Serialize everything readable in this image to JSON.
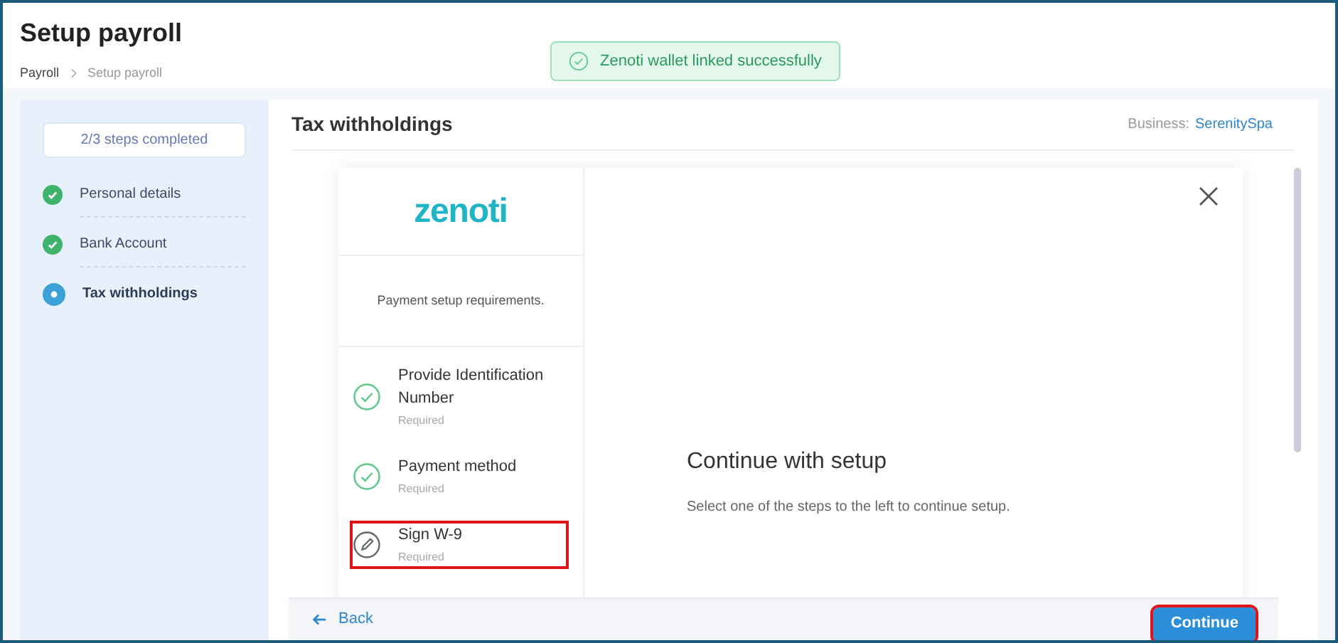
{
  "page": {
    "title": "Setup payroll",
    "breadcrumb": [
      {
        "label": "Payroll",
        "current": false
      },
      {
        "label": "Setup payroll",
        "current": true
      }
    ]
  },
  "toast": {
    "message": "Zenoti wallet linked successfully"
  },
  "stepper": {
    "progress": "2/3 steps completed",
    "steps": [
      {
        "label": "Personal details",
        "kind": "done"
      },
      {
        "label": "Bank Account",
        "kind": "done"
      },
      {
        "label": "Tax withholdings",
        "kind": "current"
      }
    ]
  },
  "section": {
    "title": "Tax withholdings",
    "business_label": "Business:",
    "business_name": "SerenitySpa"
  },
  "modal": {
    "logo": "zenoti",
    "subtitle": "Payment setup requirements.",
    "requirements": [
      {
        "title": "Provide Identification Number",
        "note": "Required",
        "kind": "done",
        "highlighted": false
      },
      {
        "title": "Payment method",
        "note": "Required",
        "kind": "done",
        "highlighted": false
      },
      {
        "title": "Sign W-9",
        "note": "Required",
        "kind": "pending",
        "highlighted": true
      }
    ],
    "heading": "Continue with setup",
    "text": "Select one of the steps to the left to continue setup."
  },
  "footer": {
    "back": "Back",
    "continue": {
      "label": "Continue",
      "highlighted": true
    }
  }
}
